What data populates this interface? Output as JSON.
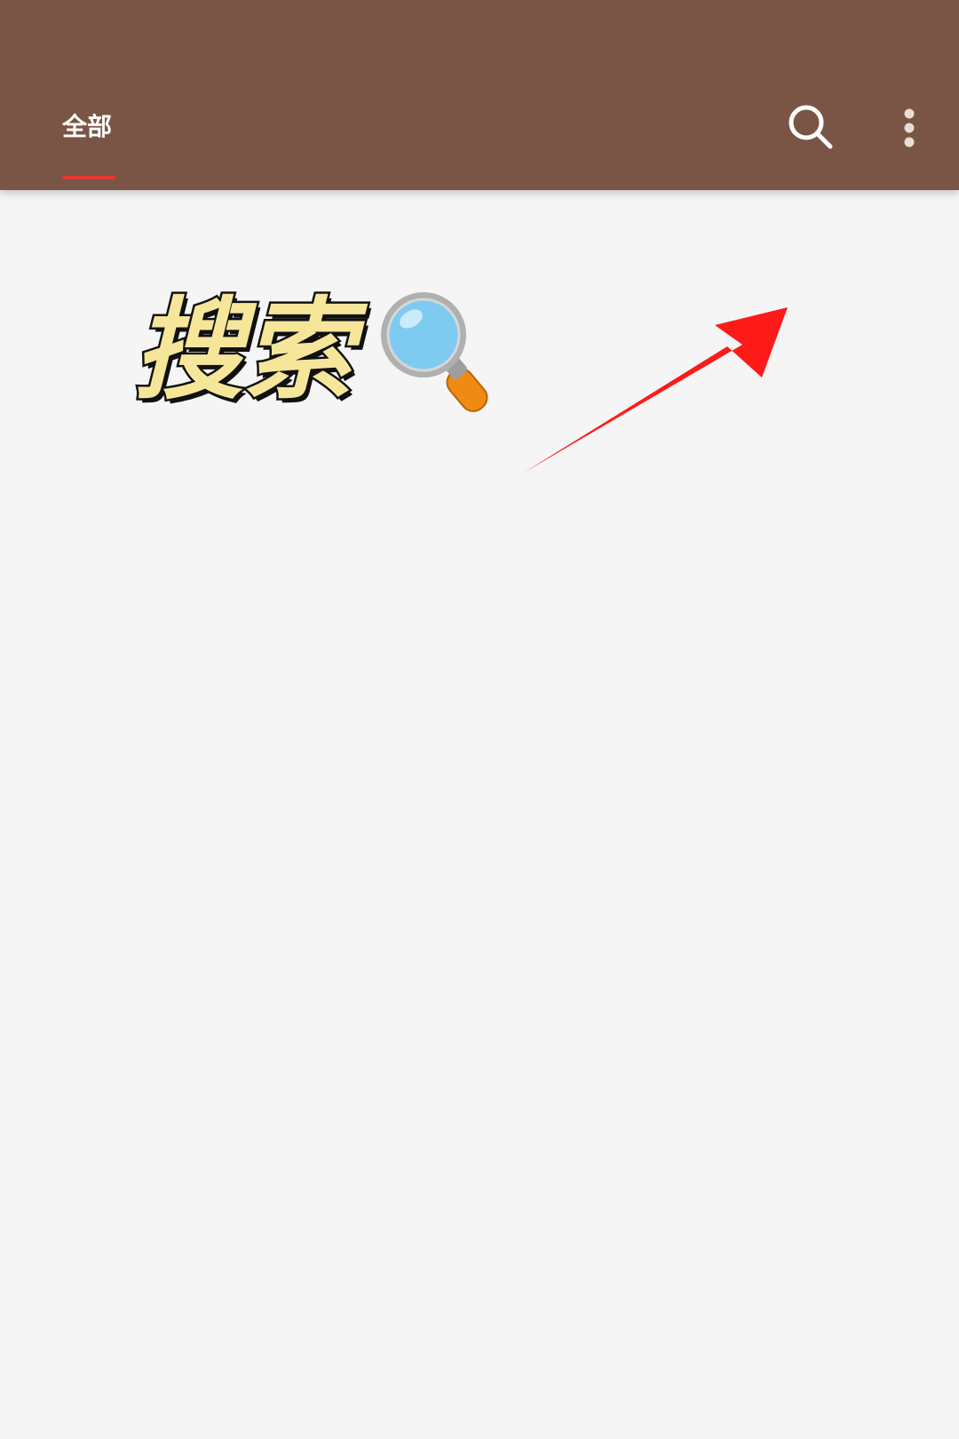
{
  "app_bar": {
    "background_color": "#7a5545",
    "tabs": [
      {
        "label": "全部",
        "active": true
      }
    ],
    "indicator_color": "#e53935",
    "actions": [
      {
        "icon": "search-icon"
      },
      {
        "icon": "more-vertical-icon"
      }
    ]
  },
  "annotation": {
    "text": "搜索",
    "icon": "magnifying-glass-emoji",
    "arrow_color": "#ff1a1a"
  },
  "content": {
    "background_color": "#f5f5f5"
  }
}
